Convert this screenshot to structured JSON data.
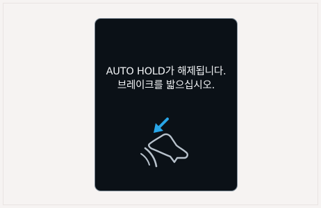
{
  "notice": {
    "line1": "AUTO HOLD가 해제됩니다.",
    "line2": "브레이크를 밟으십시오."
  },
  "icons": {
    "pedal": "brake-pedal-press-icon"
  },
  "colors": {
    "page_background": "#f6f3f2",
    "screen_background": "#0b1117",
    "screen_border": "#7e8b97",
    "text": "#f2f4f6",
    "arrow_accent": "#29a6e8",
    "icon_stroke": "#b8c2cc"
  }
}
